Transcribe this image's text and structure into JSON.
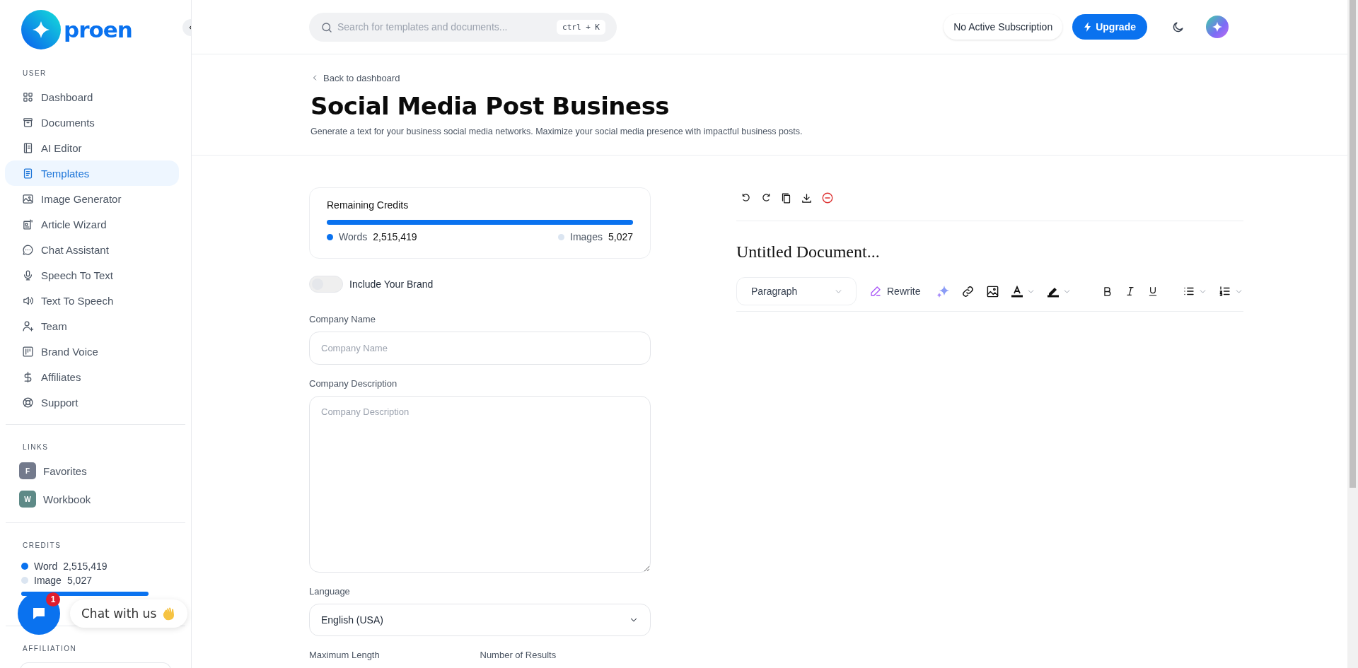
{
  "logo": {
    "text": "proen"
  },
  "sidebar": {
    "user": {
      "title": "USER",
      "items": [
        {
          "label": "Dashboard",
          "selected": false
        },
        {
          "label": "Documents",
          "selected": false
        },
        {
          "label": "AI Editor",
          "selected": false
        },
        {
          "label": "Templates",
          "selected": true
        },
        {
          "label": "Image Generator",
          "selected": false
        },
        {
          "label": "Article Wizard",
          "selected": false
        },
        {
          "label": "Chat Assistant",
          "selected": false
        },
        {
          "label": "Speech To Text",
          "selected": false
        },
        {
          "label": "Text To Speech",
          "selected": false
        },
        {
          "label": "Team",
          "selected": false
        },
        {
          "label": "Brand Voice",
          "selected": false
        },
        {
          "label": "Affiliates",
          "selected": false
        },
        {
          "label": "Support",
          "selected": false
        }
      ]
    },
    "links": {
      "title": "LINKS",
      "items": [
        {
          "badge": "F",
          "label": "Favorites",
          "color": "#737a8c"
        },
        {
          "badge": "W",
          "label": "Workbook",
          "color": "#5e8a87"
        }
      ]
    },
    "credits": {
      "title": "CREDITS",
      "items": [
        {
          "label": "Word",
          "value": "2,515,419",
          "color": "#0a72ef"
        },
        {
          "label": "Image",
          "value": "5,027",
          "color": "#dbe5f1"
        }
      ],
      "level": 1
    },
    "affiliation": {
      "title": "AFFILIATION"
    }
  },
  "header": {
    "search_placeholder": "Search for templates and documents...",
    "shortcut": "ctrl + K",
    "subscription": "No Active Subscription",
    "upgrade": "Upgrade"
  },
  "page": {
    "back": "Back to dashboard",
    "title": "Social Media Post Business",
    "description": "Generate a text for your business social media networks. Maximize your social media presence with impactful business posts."
  },
  "credits_card": {
    "title": "Remaining Credits",
    "level": 1,
    "items": [
      {
        "label": "Words",
        "value": "2,515,419",
        "color": "#0a72ef"
      },
      {
        "label": "Images",
        "value": "5,027",
        "color": "#dbe5f1"
      }
    ]
  },
  "form": {
    "toggle": {
      "label": "Include Your Brand",
      "on": false
    },
    "fields": [
      {
        "kind": "input",
        "label": "Company Name",
        "placeholder": "Company Name"
      },
      {
        "kind": "textarea",
        "label": "Company Description",
        "placeholder": "Company Description"
      },
      {
        "kind": "select",
        "label": "Language",
        "value": "English (USA)"
      }
    ],
    "more_labels": [
      "Maximum Length",
      "Number of Results"
    ]
  },
  "editor": {
    "title": "Untitled Document...",
    "block_style": "Paragraph",
    "rewrite": "Rewrite"
  },
  "chat": {
    "text": "Chat with us",
    "badge": "1"
  }
}
